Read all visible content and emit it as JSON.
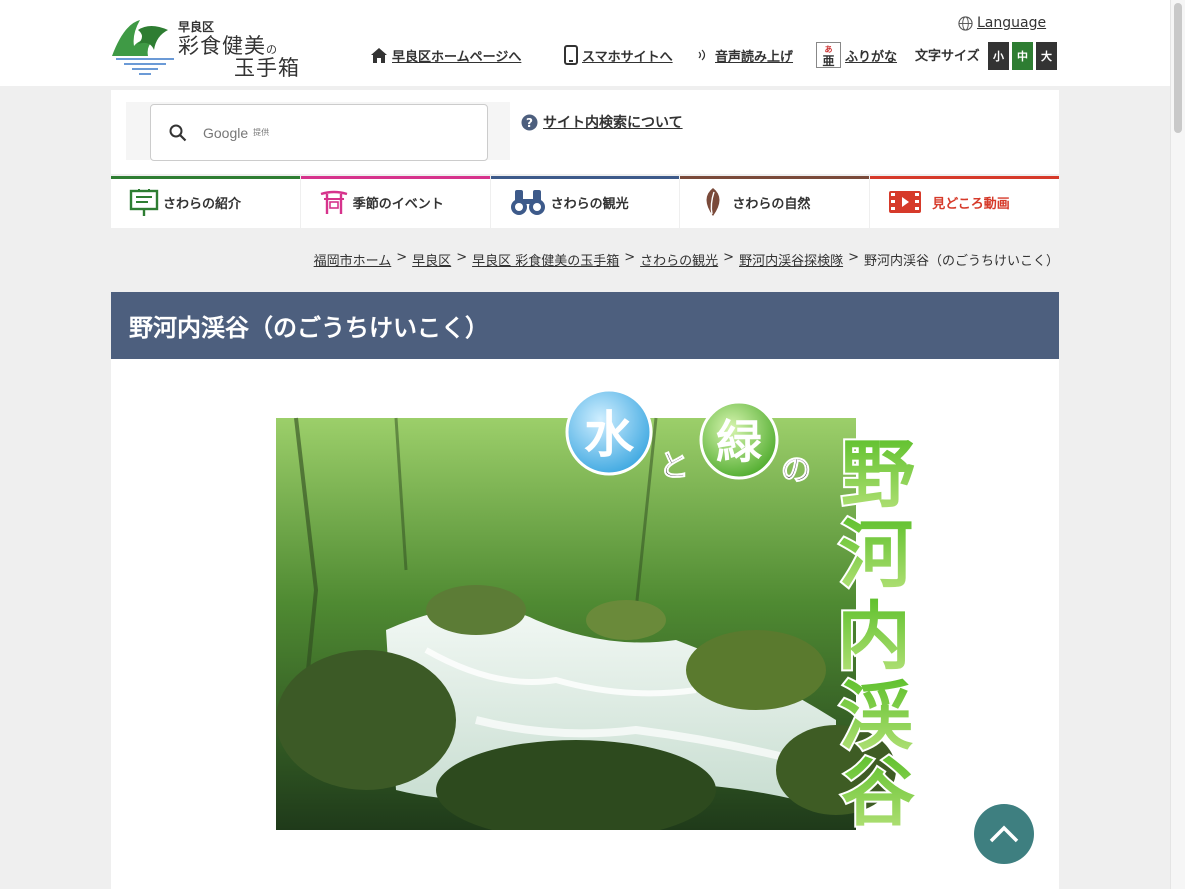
{
  "header": {
    "logo": {
      "line1": "早良区",
      "line2": "彩食健美",
      "no": "の",
      "line3": "玉手箱"
    },
    "language": "Language",
    "nav": [
      {
        "label": "早良区ホームページへ",
        "icon": "home-icon"
      },
      {
        "label": "スマホサイトへ",
        "icon": "smartphone-icon"
      },
      {
        "label": "音声読み上げ",
        "icon": "speaker-icon"
      },
      {
        "label": "ふりがな",
        "icon": "furigana-icon"
      }
    ],
    "font_size": {
      "label": "文字サイズ",
      "small": "小",
      "medium": "中",
      "large": "大"
    }
  },
  "search": {
    "provider": "Google",
    "provided": "提供",
    "about": "サイト内検索について"
  },
  "global_nav": [
    {
      "label": "さわらの紹介",
      "color": "#2e7d32",
      "icon": "signboard-icon"
    },
    {
      "label": "季節のイベント",
      "color": "#d6338c",
      "icon": "torii-icon"
    },
    {
      "label": "さわらの観光",
      "color": "#3d5a8a",
      "icon": "binoculars-icon"
    },
    {
      "label": "さわらの自然",
      "color": "#7a4a3a",
      "icon": "leaf-icon"
    },
    {
      "label": "見どころ動画",
      "color": "#d63a2a",
      "icon": "film-icon"
    }
  ],
  "breadcrumb": [
    "福岡市ホーム",
    "早良区",
    "早良区 彩食健美の玉手箱",
    "さわらの観光",
    "野河内渓谷探検隊",
    "野河内渓谷（のごうちけいこく）"
  ],
  "breadcrumb_sep": ">",
  "page_title": "野河内渓谷（のごうちけいこく）",
  "hero": {
    "mizu": "水",
    "to": "と",
    "midori": "緑",
    "no": "の",
    "name_chars": [
      "野",
      "河",
      "内",
      "渓",
      "谷"
    ]
  },
  "colors": {
    "title_bar": "#4d5f7e",
    "pagetop": "#3e7f80",
    "fs_small": "#333333",
    "fs_medium": "#2e7d32",
    "fs_large": "#333333"
  }
}
